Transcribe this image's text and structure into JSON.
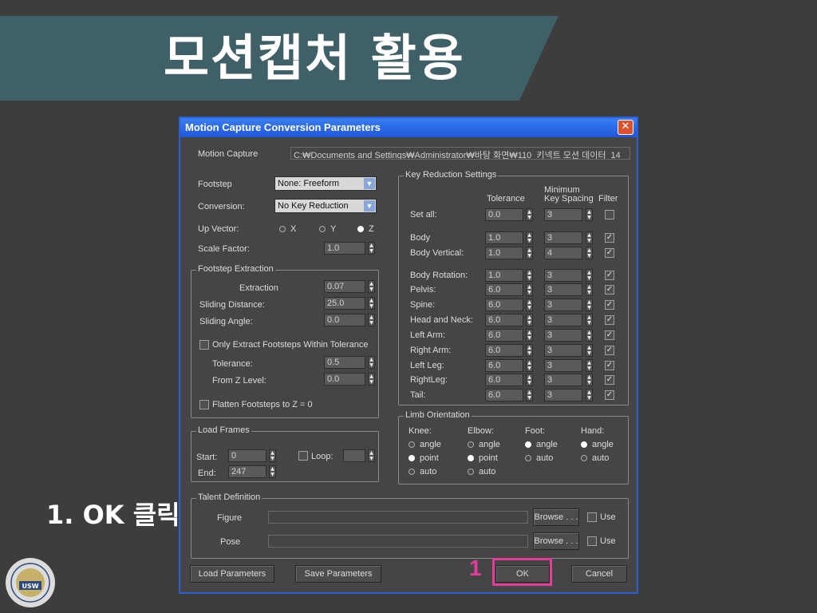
{
  "slide": {
    "title": "모션캡처 활용",
    "step_note": "1.  OK 클릭",
    "logo_text": "USW",
    "step_number": "1"
  },
  "dialog": {
    "title": "Motion Capture Conversion Parameters",
    "close_glyph": "✕",
    "motion_capture_label": "Motion Capture",
    "motion_capture_path": "C:₩Documents and Settings₩Administrator₩바탕 화면₩110_키넥트 모션 데이터_14",
    "footstep_label": "Footstep",
    "footstep_value": "None: Freeform",
    "conversion_label": "Conversion:",
    "conversion_value": "No Key Reduction",
    "up_vector_label": "Up Vector:",
    "up_vector_options": [
      "X",
      "Y",
      "Z"
    ],
    "up_vector_selected": "Z",
    "scale_factor_label": "Scale Factor:",
    "scale_factor_value": "1.0",
    "footstep_extraction": {
      "title": "Footstep Extraction",
      "extraction_label": "Extraction",
      "extraction_value": "0.07",
      "sliding_distance_label": "Sliding Distance:",
      "sliding_distance_value": "25.0",
      "sliding_angle_label": "Sliding Angle:",
      "sliding_angle_value": "0.0",
      "only_extract_label": "Only Extract Footsteps Within Tolerance",
      "tolerance_label": "Tolerance:",
      "tolerance_value": "0.5",
      "from_z_label": "From Z Level:",
      "from_z_value": "0.0",
      "flatten_label": "Flatten Footsteps to Z = 0"
    },
    "load_frames": {
      "title": "Load Frames",
      "start_label": "Start:",
      "start_value": "0",
      "end_label": "End:",
      "end_value": "247",
      "loop_label": "Loop:",
      "loop_value": ""
    },
    "key_reduction": {
      "title": "Key Reduction Settings",
      "col_tolerance": "Tolerance",
      "col_minimum": "Minimum",
      "col_key_spacing": "Key Spacing",
      "col_filter": "Filter",
      "rows": [
        {
          "label": "Set all:",
          "tolerance": "0.0",
          "spacing": "3",
          "filter": false
        },
        {
          "label": "Body",
          "tolerance": "1.0",
          "spacing": "3",
          "filter": true
        },
        {
          "label": "Body Vertical:",
          "tolerance": "1.0",
          "spacing": "4",
          "filter": true
        },
        {
          "label": "Body Rotation:",
          "tolerance": "1.0",
          "spacing": "3",
          "filter": true
        },
        {
          "label": "Pelvis:",
          "tolerance": "6.0",
          "spacing": "3",
          "filter": true
        },
        {
          "label": "Spine:",
          "tolerance": "6.0",
          "spacing": "3",
          "filter": true
        },
        {
          "label": "Head and Neck:",
          "tolerance": "6.0",
          "spacing": "3",
          "filter": true
        },
        {
          "label": "Left Arm:",
          "tolerance": "6.0",
          "spacing": "3",
          "filter": true
        },
        {
          "label": "Right Arm:",
          "tolerance": "6.0",
          "spacing": "3",
          "filter": true
        },
        {
          "label": "Left Leg:",
          "tolerance": "6.0",
          "spacing": "3",
          "filter": true
        },
        {
          "label": "RightLeg:",
          "tolerance": "6.0",
          "spacing": "3",
          "filter": true
        },
        {
          "label": "Tail:",
          "tolerance": "6.0",
          "spacing": "3",
          "filter": true
        }
      ]
    },
    "limb_orientation": {
      "title": "Limb Orientation",
      "columns": [
        {
          "label": "Knee:",
          "options": [
            "angle",
            "point",
            "auto"
          ],
          "selected": "point"
        },
        {
          "label": "Elbow:",
          "options": [
            "angle",
            "point",
            "auto"
          ],
          "selected": "point"
        },
        {
          "label": "Foot:",
          "options": [
            "angle",
            "auto"
          ],
          "selected": "angle"
        },
        {
          "label": "Hand:",
          "options": [
            "angle",
            "auto"
          ],
          "selected": "angle"
        }
      ]
    },
    "talent_definition": {
      "title": "Talent Definition",
      "figure_label": "Figure",
      "pose_label": "Pose",
      "browse_label": "Browse . . .",
      "use_label": "Use"
    },
    "buttons": {
      "load_parameters": "Load Parameters",
      "save_parameters": "Save Parameters",
      "ok": "OK",
      "cancel": "Cancel"
    }
  }
}
